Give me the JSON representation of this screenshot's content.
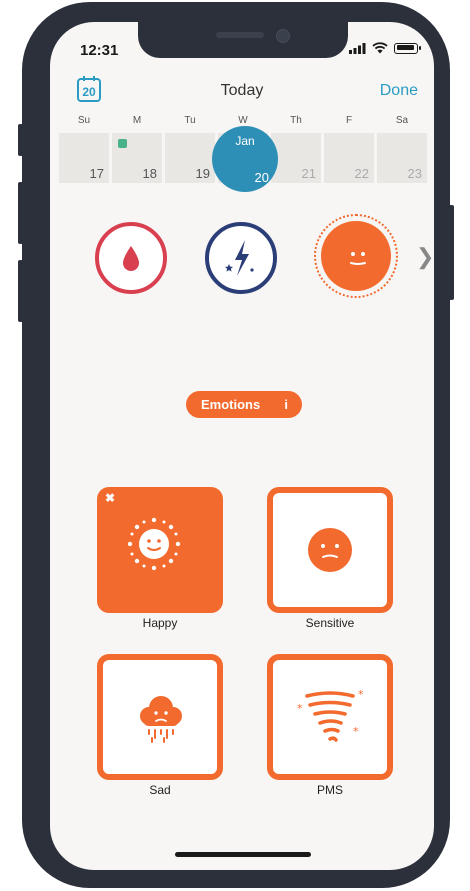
{
  "status": {
    "time": "12:31"
  },
  "header": {
    "calendar_day": "20",
    "title": "Today",
    "done_label": "Done"
  },
  "week": {
    "weekdays": [
      "Su",
      "M",
      "Tu",
      "W",
      "Th",
      "F",
      "Sa"
    ],
    "days": [
      "17",
      "18",
      "19",
      "20",
      "21",
      "22",
      "23"
    ],
    "selected_month": "Jan",
    "selected_day": "20"
  },
  "categories": {
    "names": [
      "blood-drop-icon",
      "energy-bolt-icon",
      "emotion-face-icon"
    ],
    "selected": "emotion"
  },
  "section": {
    "label": "Emotions",
    "info": "i"
  },
  "emotions": [
    {
      "label": "Happy",
      "selected": true
    },
    {
      "label": "Sensitive",
      "selected": false
    },
    {
      "label": "Sad",
      "selected": false
    },
    {
      "label": "PMS",
      "selected": false
    }
  ],
  "colors": {
    "accent": "#f26a2e",
    "blue": "#2a9cc4",
    "today": "#2e8fb6",
    "red": "#d9404f",
    "navy": "#2c3e78"
  }
}
